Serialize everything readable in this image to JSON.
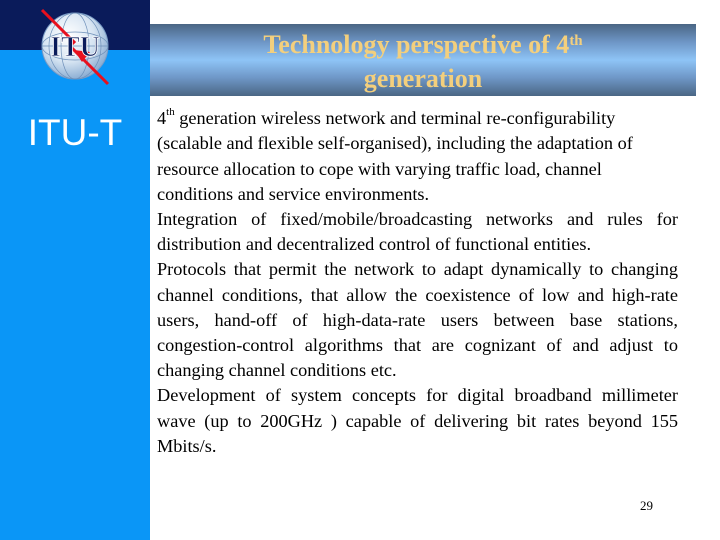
{
  "sidebar": {
    "logo_text": "ITU",
    "label": "ITU-T",
    "colors": {
      "top": "#0a1b5a",
      "bottom": "#0a96f7"
    }
  },
  "title": {
    "main": "Technology perspective of 4",
    "superscript": "th",
    "line2": "generation",
    "color": "#f3cf7d"
  },
  "content": {
    "paragraphs": [
      {
        "prefix": "4",
        "prefix_sup": "th",
        "text": "  generation wireless network and terminal re-configurability (scalable and flexible self-organised), including the adaptation of resource allocation to cope with varying traffic load, channel conditions and service environments."
      },
      {
        "text": "Integration of fixed/mobile/broadcasting networks and rules for distribution and decentralized control of functional entities."
      },
      {
        "text": "Protocols that permit the network to adapt dynamically to changing channel conditions, that allow the coexistence of low and high-rate users, hand-off of high-data-rate users between base stations, congestion-control algorithms that are cognizant of and adjust to changing channel conditions etc."
      },
      {
        "text": "Development of system concepts for digital broadband millimeter wave (up to 200GHz ) capable of delivering bit rates beyond 155 Mbits/s."
      }
    ]
  },
  "footer": {
    "page_number": "29"
  }
}
